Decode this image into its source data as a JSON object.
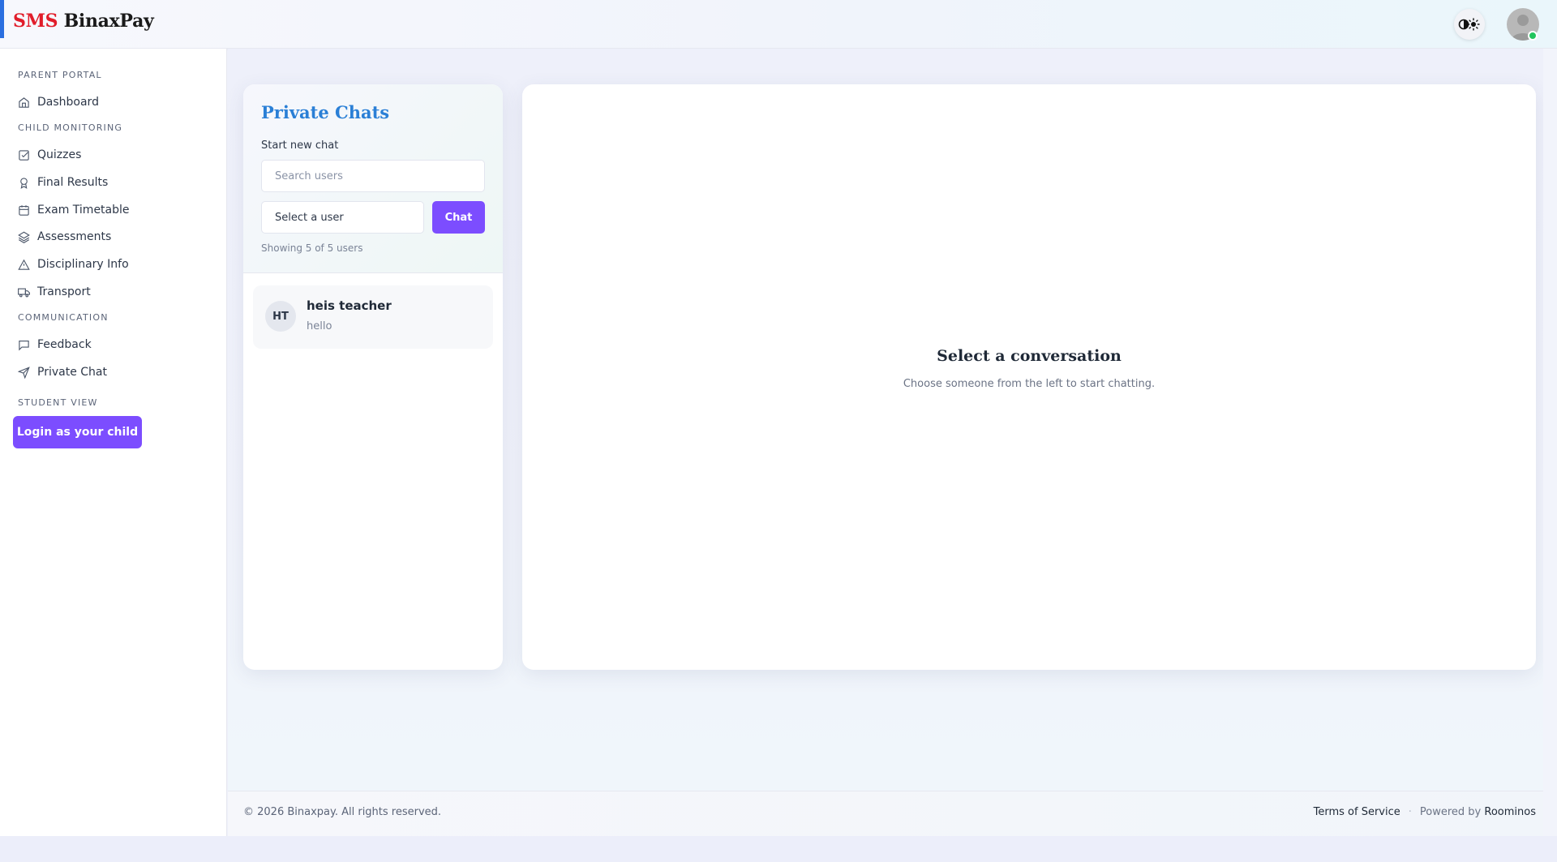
{
  "brand": {
    "prefix": "SMS",
    "name": "BinaxPay"
  },
  "colors": {
    "accent": "#7c4dff",
    "brand_red": "#e11d2a",
    "title_blue": "#2a7fd6",
    "online": "#22c55e"
  },
  "sidebar": {
    "sections": [
      {
        "title": "PARENT PORTAL",
        "items": [
          {
            "label": "Dashboard",
            "icon": "home-icon"
          }
        ]
      },
      {
        "title": "CHILD MONITORING",
        "items": [
          {
            "label": "Quizzes",
            "icon": "checkbox-icon"
          },
          {
            "label": "Final Results",
            "icon": "award-icon"
          },
          {
            "label": "Exam Timetable",
            "icon": "calendar-icon"
          },
          {
            "label": "Assessments",
            "icon": "layers-icon"
          },
          {
            "label": "Disciplinary Info",
            "icon": "alert-triangle-icon"
          },
          {
            "label": "Transport",
            "icon": "truck-icon"
          }
        ]
      },
      {
        "title": "COMMUNICATION",
        "items": [
          {
            "label": "Feedback",
            "icon": "message-square-icon"
          },
          {
            "label": "Private Chat",
            "icon": "send-icon"
          }
        ]
      },
      {
        "title": "STUDENT VIEW",
        "items": []
      }
    ],
    "login_child_label": "Login as your child"
  },
  "chats": {
    "title": "Private Chats",
    "start_label": "Start new chat",
    "search_placeholder": "Search users",
    "select_placeholder": "Select a user",
    "chat_button": "Chat",
    "showing": "Showing 5 of 5 users",
    "conversations": [
      {
        "initials": "HT",
        "name": "heis teacher",
        "preview": "hello"
      }
    ]
  },
  "conversation": {
    "empty_title": "Select a conversation",
    "empty_subtitle": "Choose someone from the left to start chatting."
  },
  "footer": {
    "copyright": "© 2026 Binaxpay. All rights reserved.",
    "terms": "Terms of Service",
    "separator": "·",
    "powered_by": "Powered by",
    "powered_name": "Roominos"
  }
}
